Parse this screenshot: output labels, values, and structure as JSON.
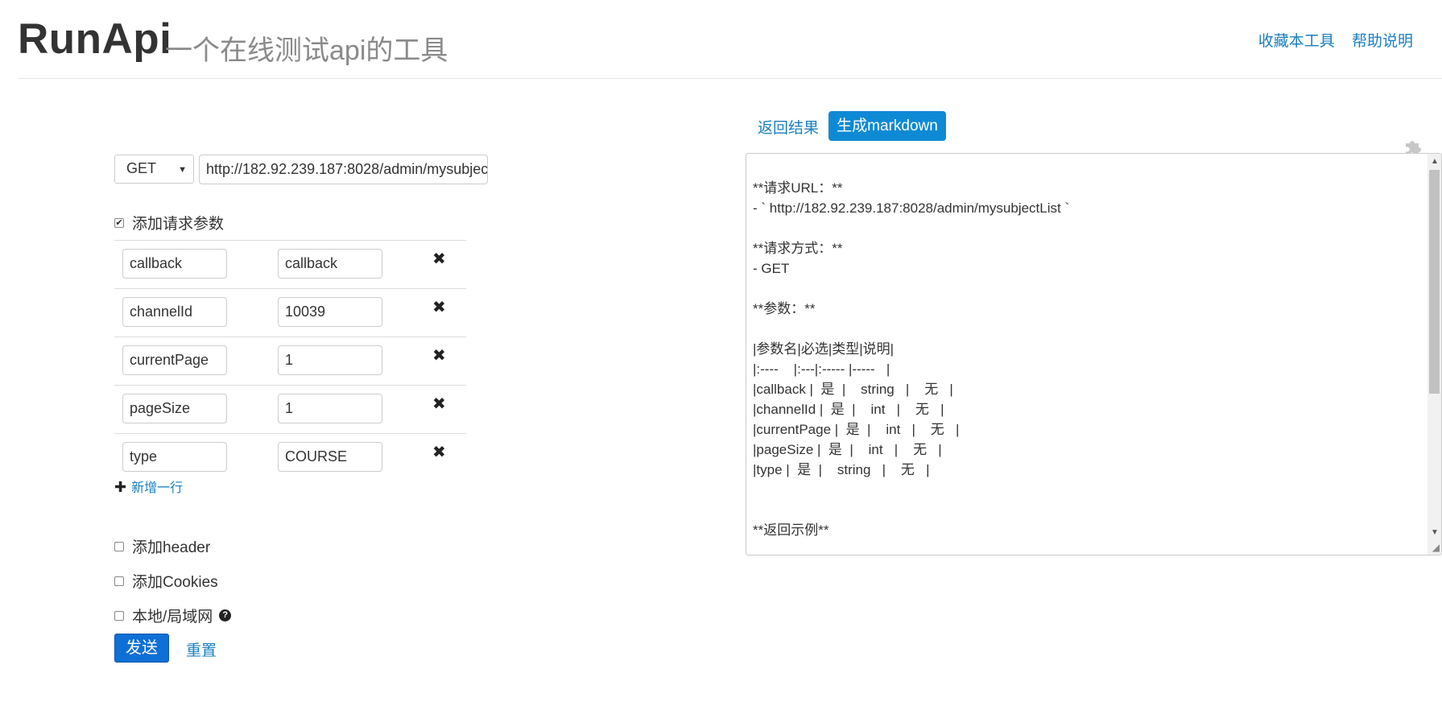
{
  "header": {
    "brand": "RunApi",
    "subtitle": "一个在线测试api的工具",
    "links": [
      "收藏本工具",
      "帮助说明"
    ]
  },
  "request": {
    "method": "GET",
    "url": "http://182.92.239.187:8028/admin/mysubjec"
  },
  "params_section": {
    "label": "添加请求参数",
    "checked": true,
    "rows": [
      {
        "key": "callback",
        "value": "callback"
      },
      {
        "key": "channelId",
        "value": "10039"
      },
      {
        "key": "currentPage",
        "value": "1"
      },
      {
        "key": "pageSize",
        "value": "1"
      },
      {
        "key": "type",
        "value": "COURSE"
      }
    ],
    "delete_icon": "✖",
    "add_row_label": "新增一行"
  },
  "options": {
    "header_label": "添加header",
    "cookies_label": "添加Cookies",
    "local_label": "本地/局域网",
    "help_icon": "?"
  },
  "actions": {
    "send_label": "发送",
    "reset_label": "重置"
  },
  "result_tabs": {
    "result_label": "返回结果",
    "markdown_label": "生成markdown",
    "active": "markdown"
  },
  "markdown": {
    "content": "**请求URL：**\n- ` http://182.92.239.187:8028/admin/mysubjectList `\n\n**请求方式：**\n- GET\n\n**参数：**\n\n|参数名|必选|类型|说明|\n|:----    |:---|:----- |-----   |\n|callback |  是  |    string   |    无   |\n|channelId |  是  |    int   |    无   |\n|currentPage |  是  |    int   |    无   |\n|pageSize |  是  |    int   |    无   |\n|type |  是  |    string   |    无   |\n\n\n**返回示例**"
  },
  "colors": {
    "link": "#1a7fc0",
    "primary_button": "#0e6fd6",
    "active_tab": "#0e8ad4"
  }
}
